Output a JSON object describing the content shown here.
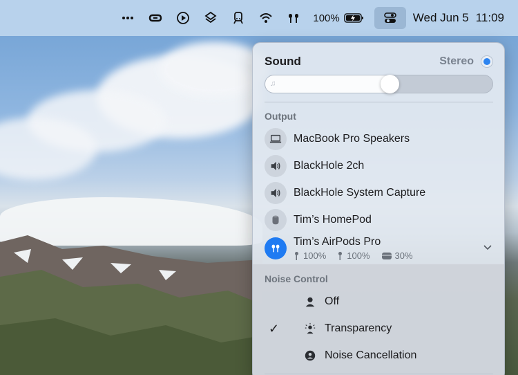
{
  "menubar": {
    "icons": [
      "more-icon",
      "creative-cloud-icon",
      "play-icon",
      "stack-icon",
      "train-icon",
      "wifi-icon",
      "airpods-icon"
    ],
    "battery": "100%",
    "date": "Wed Jun 5",
    "time": "11:09"
  },
  "sound": {
    "title": "Sound",
    "mode": "Stereo",
    "volume": 0.55
  },
  "output": {
    "label": "Output",
    "devices": [
      {
        "name": "MacBook Pro Speakers",
        "icon": "laptop-icon"
      },
      {
        "name": "BlackHole 2ch",
        "icon": "speaker-icon"
      },
      {
        "name": "BlackHole System Capture",
        "icon": "speaker-icon"
      },
      {
        "name": "Tim’s HomePod",
        "icon": "homepod-icon"
      }
    ],
    "airpods": {
      "name": "Tim’s AirPods Pro",
      "left": "100%",
      "right": "100%",
      "case": "30%"
    }
  },
  "noise": {
    "label": "Noise Control",
    "options": [
      {
        "name": "Off",
        "checked": false
      },
      {
        "name": "Transparency",
        "checked": true
      },
      {
        "name": "Noise Cancellation",
        "checked": false
      }
    ],
    "check_glyph": "✓"
  },
  "colors": {
    "accent": "#1f7bf2"
  }
}
